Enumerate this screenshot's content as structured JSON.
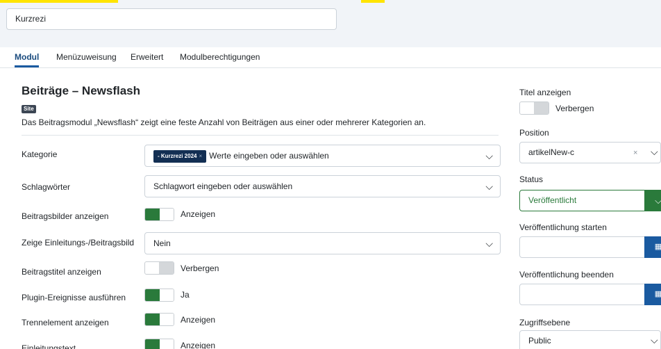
{
  "module_title": "Kurzrezi",
  "tabs": [
    {
      "label": "Modul",
      "active": true
    },
    {
      "label": "Menüzuweisung",
      "active": false
    },
    {
      "label": "Erweitert",
      "active": false
    },
    {
      "label": "Modulberechtigungen",
      "active": false
    }
  ],
  "module": {
    "heading": "Beiträge – Newsflash",
    "badge": "Site",
    "description": "Das Beitragsmodul „Newsflash“ zeigt eine feste Anzahl von Beiträgen aus einer oder mehrerer Kategorien an."
  },
  "fields": {
    "kategorie": {
      "label": "Kategorie",
      "tag": "- Kurzrezi 2024",
      "tag_remove": "×",
      "placeholder": "Werte eingeben oder auswählen"
    },
    "schlagwoerter": {
      "label": "Schlagwörter",
      "placeholder": "Schlagwort eingeben oder auswählen"
    },
    "beitragsbilder": {
      "label": "Beitragsbilder anzeigen",
      "state": "on",
      "value": "Anzeigen"
    },
    "einleitungsbild": {
      "label": "Zeige Einleitungs-/Beitragsbild",
      "value": "Nein"
    },
    "beitragstitel": {
      "label": "Beitragstitel anzeigen",
      "state": "off",
      "value": "Verbergen"
    },
    "plugin": {
      "label": "Plugin-Ereignisse ausführen",
      "state": "on",
      "value": "Ja"
    },
    "trennelement": {
      "label": "Trennelement anzeigen",
      "state": "on",
      "value": "Anzeigen"
    },
    "einleitungstext": {
      "label": "Einleitungstext",
      "state": "on",
      "value": "Anzeigen"
    }
  },
  "sidebar": {
    "titel_anzeigen": {
      "label": "Titel anzeigen",
      "state": "off",
      "value": "Verbergen"
    },
    "position": {
      "label": "Position",
      "value": "artikelNew-c",
      "clear": "×"
    },
    "status": {
      "label": "Status",
      "value": "Veröffentlicht"
    },
    "publish_start": {
      "label": "Veröffentlichung starten",
      "value": ""
    },
    "publish_end": {
      "label": "Veröffentlichung beenden",
      "value": ""
    },
    "access": {
      "label": "Zugriffsebene",
      "value": "Public"
    }
  },
  "icons": {
    "chevron": "⌵",
    "calendar": "▦"
  },
  "colors": {
    "primary": "#1a5aa0",
    "success": "#2a7a3b",
    "tag": "#132f53",
    "highlight": "#ffe400"
  }
}
